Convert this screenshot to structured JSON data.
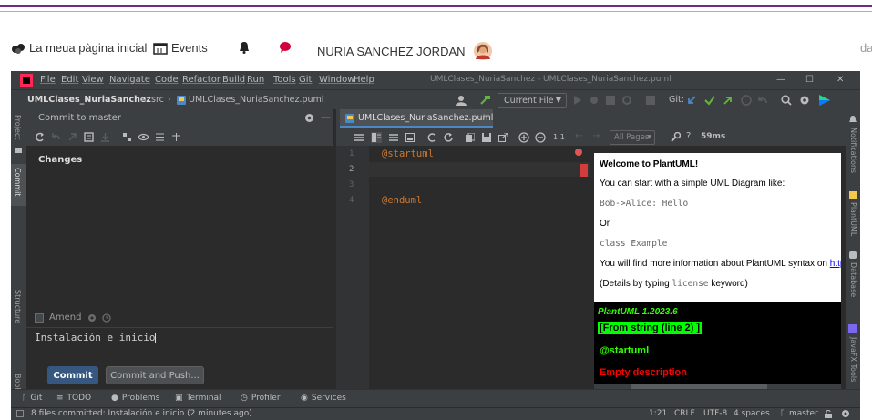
{
  "site": {
    "home": "La meua pàgina inicial",
    "events": "Events",
    "user_name": "NURIA SANCHEZ JORDAN",
    "right_cut": "dar"
  },
  "ide": {
    "menu": [
      "File",
      "Edit",
      "View",
      "Navigate",
      "Code",
      "Refactor",
      "Build",
      "Run",
      "Tools",
      "Git",
      "Window",
      "Help"
    ],
    "window_title": "UMLClases_NuriaSanchez - UMLClases_NuriaSanchez.puml",
    "breadcrumb": {
      "project": "UMLClases_NuriaSanchez",
      "folder": "src",
      "file": "UMLClases_NuriaSanchez.puml"
    },
    "run_config": "Current File",
    "git_label": "Git:",
    "left_strip": [
      "Project",
      "Commit",
      "Structure",
      "Bookmarks"
    ],
    "right_strip": [
      "Notifications",
      "PlantUML",
      "Database",
      "JavaFX Tools"
    ],
    "commit": {
      "header": "Commit to master",
      "changes_label": "Changes",
      "amend_label": "Amend",
      "message": "Instalación e inicio",
      "commit_button": "Commit",
      "commit_push_button": "Commit and Push..."
    },
    "editor": {
      "tab": "UMLClases_NuriaSanchez.puml",
      "line_numbers": [
        "1",
        "2",
        "3",
        "4"
      ],
      "lines": [
        "@startuml",
        "",
        "",
        "@enduml"
      ]
    },
    "preview": {
      "all_pages": "All Pages",
      "ratio": "1:1",
      "timing": "59ms",
      "welcome_title": "Welcome to PlantUML!",
      "line1": "You can start with a simple UML Diagram like:",
      "example1": "Bob->Alice: Hello",
      "or": "Or",
      "example2": "class Example",
      "line2": "You will find more information about PlantUML syntax on",
      "line2_link": "http",
      "details_prefix": "(Details by typing",
      "details_code": "license",
      "details_suffix": "keyword)",
      "version": "PlantUML 1.2023.6",
      "from_string": "[From string (line 2) ]",
      "startuml": "@startuml",
      "empty_desc": "Empty description"
    },
    "tool_windows": [
      "Git",
      "TODO",
      "Problems",
      "Terminal",
      "Profiler",
      "Services"
    ],
    "status": {
      "message": "8 files committed: Instalación e inicio (2 minutes ago)",
      "position": "1:21",
      "line_sep": "CRLF",
      "encoding": "UTF-8",
      "indent": "4 spaces",
      "branch": "master"
    },
    "colors": {
      "commit_button": "#365880",
      "error_red": "#ff0000",
      "highlight_green": "#00ff00",
      "version_green": "#33ff02"
    }
  }
}
